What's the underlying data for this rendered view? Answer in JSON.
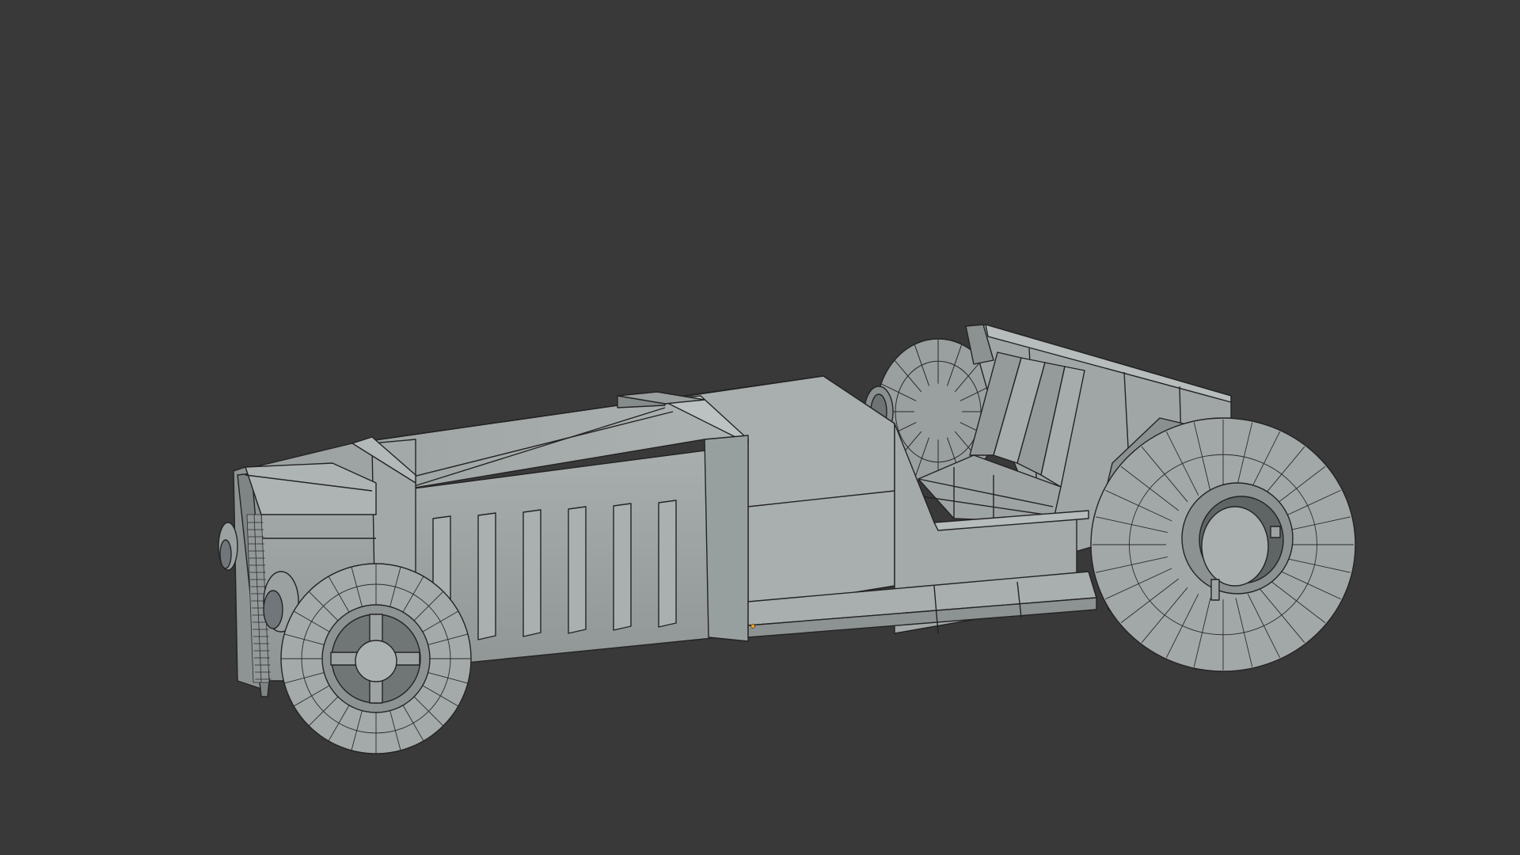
{
  "viewport": {
    "background": "#393939",
    "object": "wireframe-car-model",
    "shading": "solid",
    "overlay": "wireframe",
    "colors": {
      "body_light": "#a7adac",
      "body_mid": "#959b9a",
      "body_dark": "#7d8382",
      "shadow": "#5f6564",
      "edge": "#222222",
      "origin": "#f0a020"
    }
  }
}
